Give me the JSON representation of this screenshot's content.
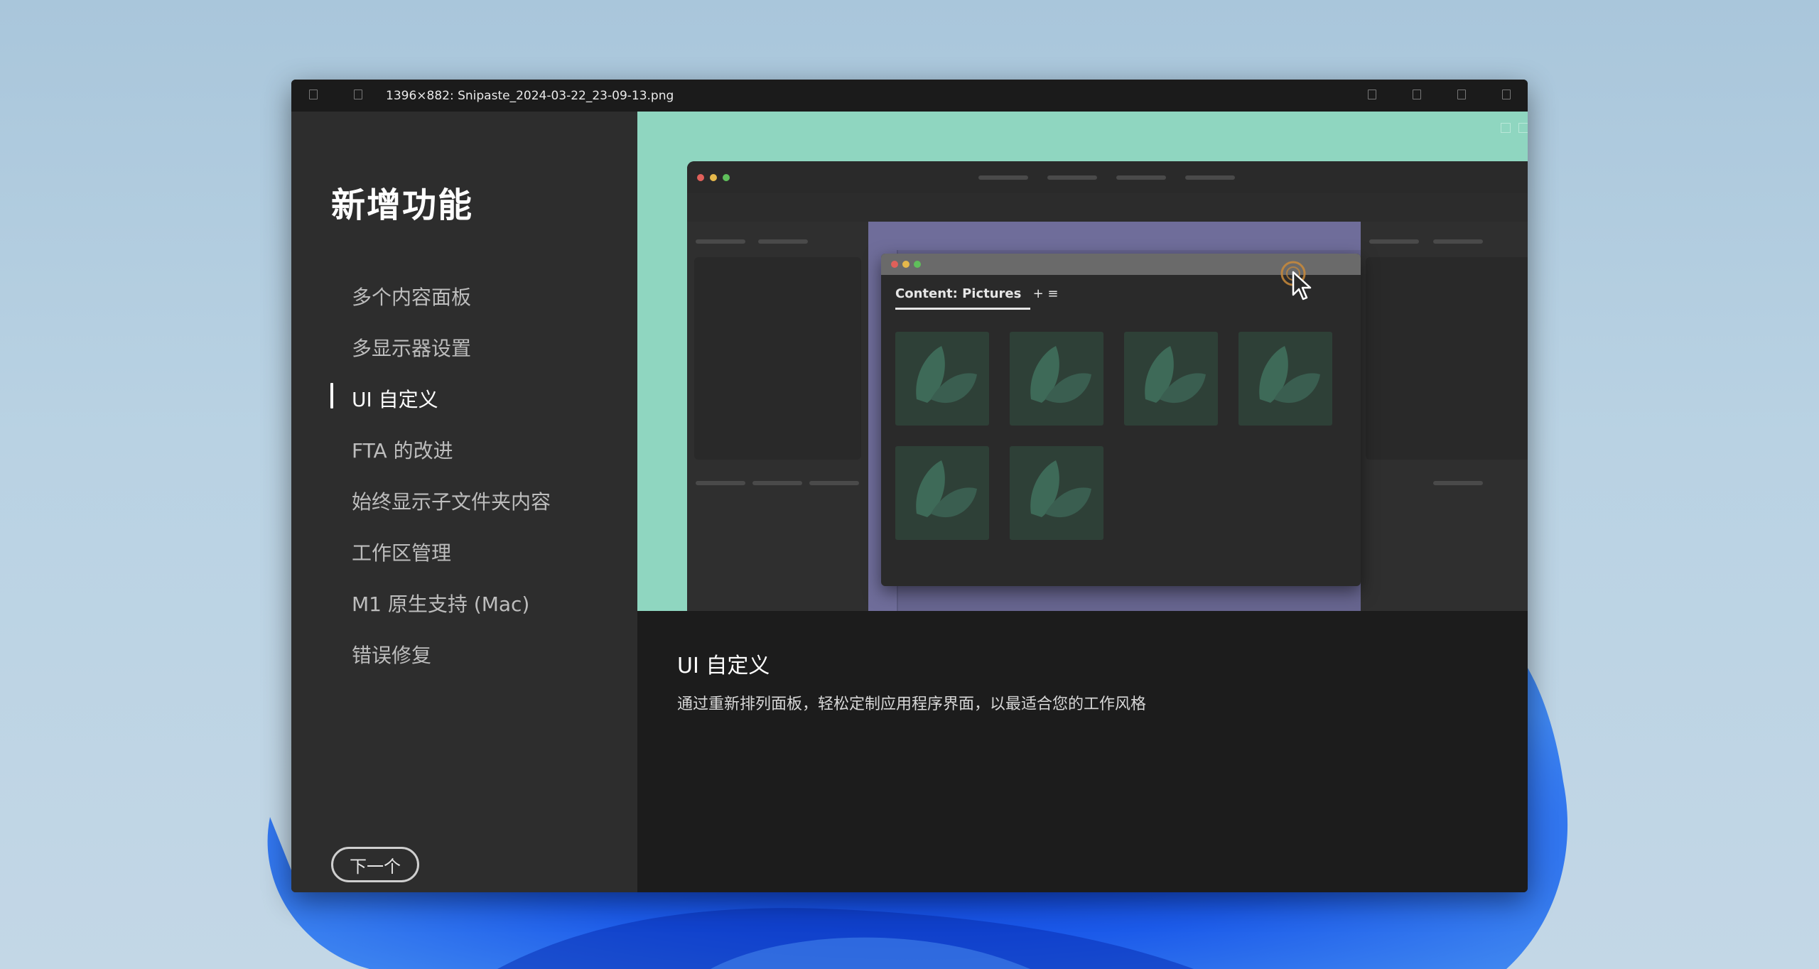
{
  "window": {
    "title": "1396×882: Snipaste_2024-03-22_23-09-13.png"
  },
  "sidebar": {
    "title": "新增功能",
    "items": [
      {
        "label": "多个内容面板"
      },
      {
        "label": "多显示器设置"
      },
      {
        "label": "UI 自定义",
        "active": true
      },
      {
        "label": "FTA 的改进"
      },
      {
        "label": "始终显示子文件夹内容"
      },
      {
        "label": "工作区管理"
      },
      {
        "label": "M1 原生支持 (Mac)"
      },
      {
        "label": "错误修复"
      }
    ],
    "next_label": "下一个"
  },
  "hero": {
    "panel_tab_label": "Content: Pictures",
    "panel_tab_actions": "+ ≡",
    "background_color": "#8fd6c0"
  },
  "description": {
    "title": "UI 自定义",
    "body": "通过重新排列面板，轻松定制应用程序界面，以最适合您的工作风格"
  }
}
